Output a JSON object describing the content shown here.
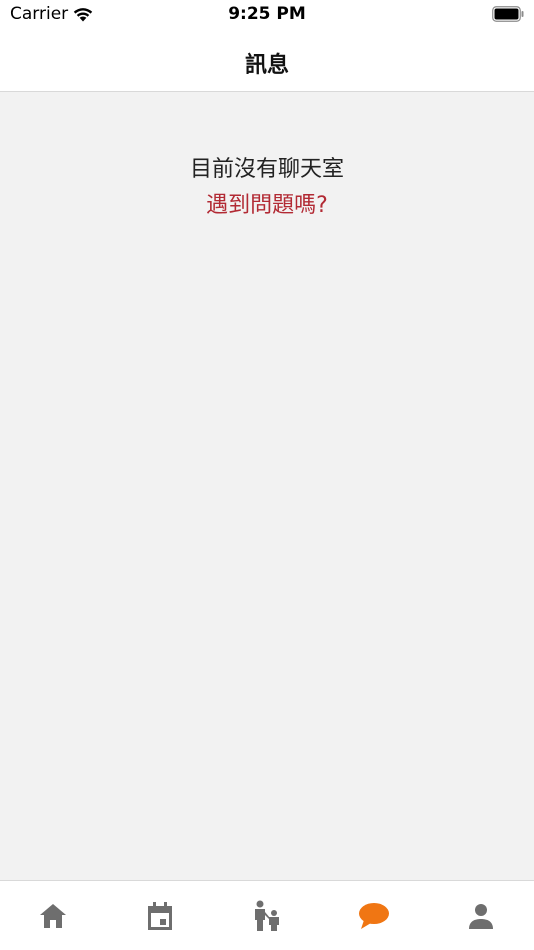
{
  "status_bar": {
    "carrier": "Carrier",
    "time": "9:25 PM"
  },
  "header": {
    "title": "訊息"
  },
  "empty_state": {
    "message": "目前沒有聊天室",
    "help_link": "遇到問題嗎?"
  },
  "tab_bar": {
    "tabs": [
      {
        "icon": "home-icon",
        "active": false
      },
      {
        "icon": "calendar-icon",
        "active": false
      },
      {
        "icon": "family-icon",
        "active": false
      },
      {
        "icon": "chat-bubble-icon",
        "active": true
      },
      {
        "icon": "person-icon",
        "active": false
      }
    ]
  },
  "colors": {
    "active_tab": "#f07613",
    "inactive_tab": "#6e6e6e",
    "link": "#b22a34",
    "background": "#f2f2f2"
  }
}
